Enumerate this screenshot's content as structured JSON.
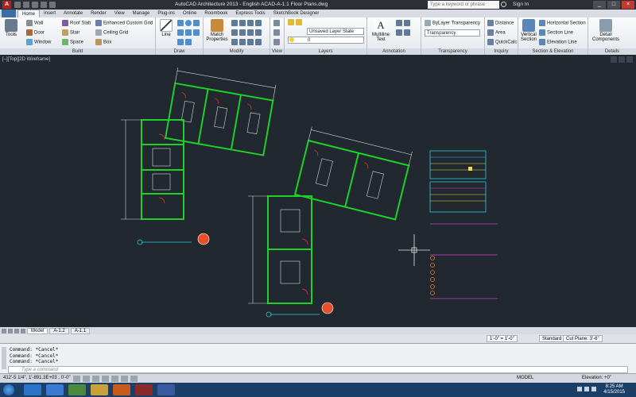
{
  "window": {
    "title": "AutoCAD Architecture 2013 - English    ACAD-A-1.1 Floor Plans.dwg",
    "search_placeholder": "Type a keyword or phrase",
    "sign_in": "Sign In"
  },
  "ribbon_tabs": [
    "Home",
    "Insert",
    "Annotate",
    "Render",
    "View",
    "Manage",
    "Plug-ins",
    "Online",
    "Roombook",
    "Express Tools",
    "SketchBook Designer"
  ],
  "build": {
    "tools": "Tools",
    "wall": "Wall",
    "door": "Door",
    "window": "Window",
    "roof_slab": "Roof Slab",
    "stair": "Stair",
    "space": "Space",
    "enhanced_grid": "Enhanced Custom Grid",
    "ceiling_grid": "Ceiling Grid",
    "box": "Box",
    "title": "Build"
  },
  "draw": {
    "line": "Line",
    "title": "Draw"
  },
  "modify": {
    "match": "Match Properties",
    "title": "Modify"
  },
  "view": {
    "title": "View"
  },
  "layers": {
    "state": "Unsaved Layer State",
    "current": "0",
    "title": "Layers"
  },
  "annotation": {
    "mtext": "Multiline Text",
    "title": "Annotation"
  },
  "transparency": {
    "bylayer": "ByLayer Transparency",
    "field": "Transparency",
    "title": "Transparency"
  },
  "inquiry": {
    "distance": "Distance",
    "area": "Area",
    "quickcalc": "QuickCalc",
    "title": "Inquiry"
  },
  "section": {
    "vertical": "Vertical Section",
    "horizontal": "Horizontal Section",
    "line": "Section Line",
    "elevation": "Elevation Line",
    "title": "Section & Elevation"
  },
  "details": {
    "components": "Detail Components",
    "title": "Details"
  },
  "viewport": {
    "label": "[–][Top][2D Wireframe]"
  },
  "layout_tabs": [
    "Model",
    "A-1.2",
    "A-1.1"
  ],
  "annotation_bar": {
    "scale": "1'-0\" = 1'-0\"",
    "standard": "Standard",
    "cut_plane": "Cut Plane: 3'-6\""
  },
  "command": {
    "history": [
      "Command: *Cancel*",
      "Command: *Cancel*",
      "Command: *Cancel*"
    ],
    "prompt": "Type a command"
  },
  "status": {
    "coords": "412'-5 1/4\", 1'-891.3E+03 , 0'-0\"",
    "model": "MODEL",
    "elevation": "Elevation: +0\""
  },
  "clock": {
    "time": "8:25 AM",
    "date": "4/15/2015"
  },
  "colors": {
    "wall": "#1fcf2a",
    "door": "#e23a2a",
    "dim": "#d8d8d8",
    "cyan": "#2ec8e0",
    "yellow": "#f2e12c",
    "magenta": "#d43fd4",
    "orange": "#e07a2a"
  }
}
